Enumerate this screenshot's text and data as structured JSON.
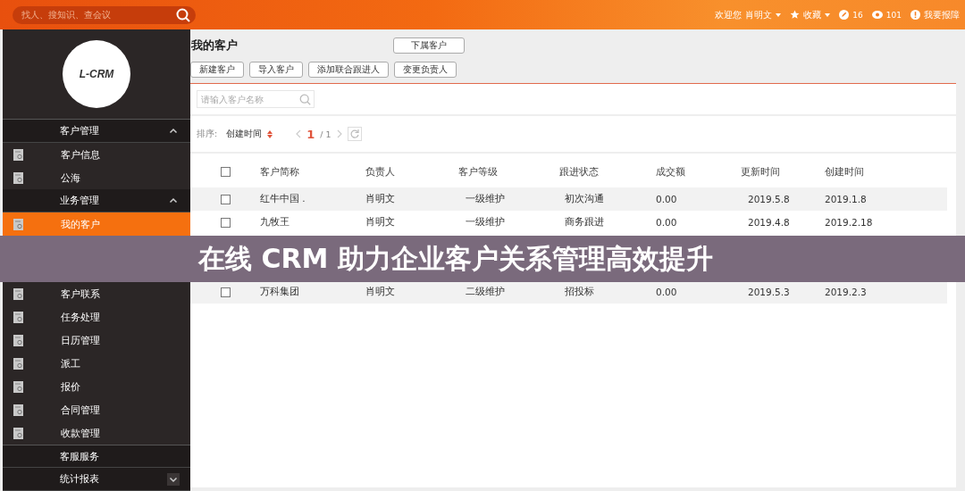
{
  "top_bar": {
    "search": {
      "placeholder": "找人、搜知识、查会议"
    },
    "welcome": "欢迎您",
    "user": "肖明文",
    "favorites": "收藏",
    "edits_count": "16",
    "views_count": "101",
    "report": "我要报障"
  },
  "sidebar": {
    "logo": "L-CRM",
    "items": [
      {
        "label": "客户管理",
        "kind": "section",
        "expanded": true,
        "children": [
          {
            "label": "客户信息",
            "selected": false
          },
          {
            "label": "公海",
            "selected": false
          }
        ]
      },
      {
        "label": "业务管理",
        "kind": "section",
        "expanded": true,
        "children": [
          {
            "label": "我的客户",
            "selected": true
          },
          {
            "label": "客户联系",
            "selected": false
          },
          {
            "label": "任务处理",
            "selected": false
          },
          {
            "label": "日历管理",
            "selected": false
          },
          {
            "label": "派工",
            "selected": false
          },
          {
            "label": "报价",
            "selected": false
          },
          {
            "label": "合同管理",
            "selected": false
          },
          {
            "label": "收款管理",
            "selected": false
          }
        ]
      },
      {
        "label": "客服服务",
        "kind": "plain"
      },
      {
        "label": "统计报表",
        "kind": "section",
        "expanded": false
      }
    ]
  },
  "page": {
    "title": "我的客户",
    "sub_button": "下属客户",
    "actions": [
      "新建客户",
      "导入客户",
      "添加联合跟进人",
      "变更负责人"
    ],
    "search": {
      "placeholder": "请输入客户名称"
    },
    "sort": {
      "label": "排序:",
      "field": "创建时间",
      "page": "1",
      "total": "/ 1"
    },
    "table": {
      "select_all_checked": false,
      "columns": [
        "客户简称",
        "负责人",
        "客户等级",
        "跟进状态",
        "成交额",
        "更新时间",
        "创建时间"
      ],
      "rows": [
        {
          "checked": false,
          "cells": [
            "红牛中国 .",
            "肖明文",
            "一级维护",
            "初次沟通",
            "0.00",
            "2019.5.8",
            "2019.1.8"
          ]
        },
        {
          "checked": false,
          "cells": [
            "九牧王",
            "肖明文",
            "一级维护",
            "商务跟进",
            "0.00",
            "2019.4.8",
            "2019.2.18"
          ]
        },
        {
          "checked": false,
          "cells": [
            "万科集团",
            "肖明文",
            "二级维护",
            "招投标",
            "0.00",
            "2019.5.3",
            "2019.2.3"
          ]
        }
      ]
    }
  },
  "banner": {
    "title": "在线 CRM 助力企业客户关系管理高效提升"
  }
}
